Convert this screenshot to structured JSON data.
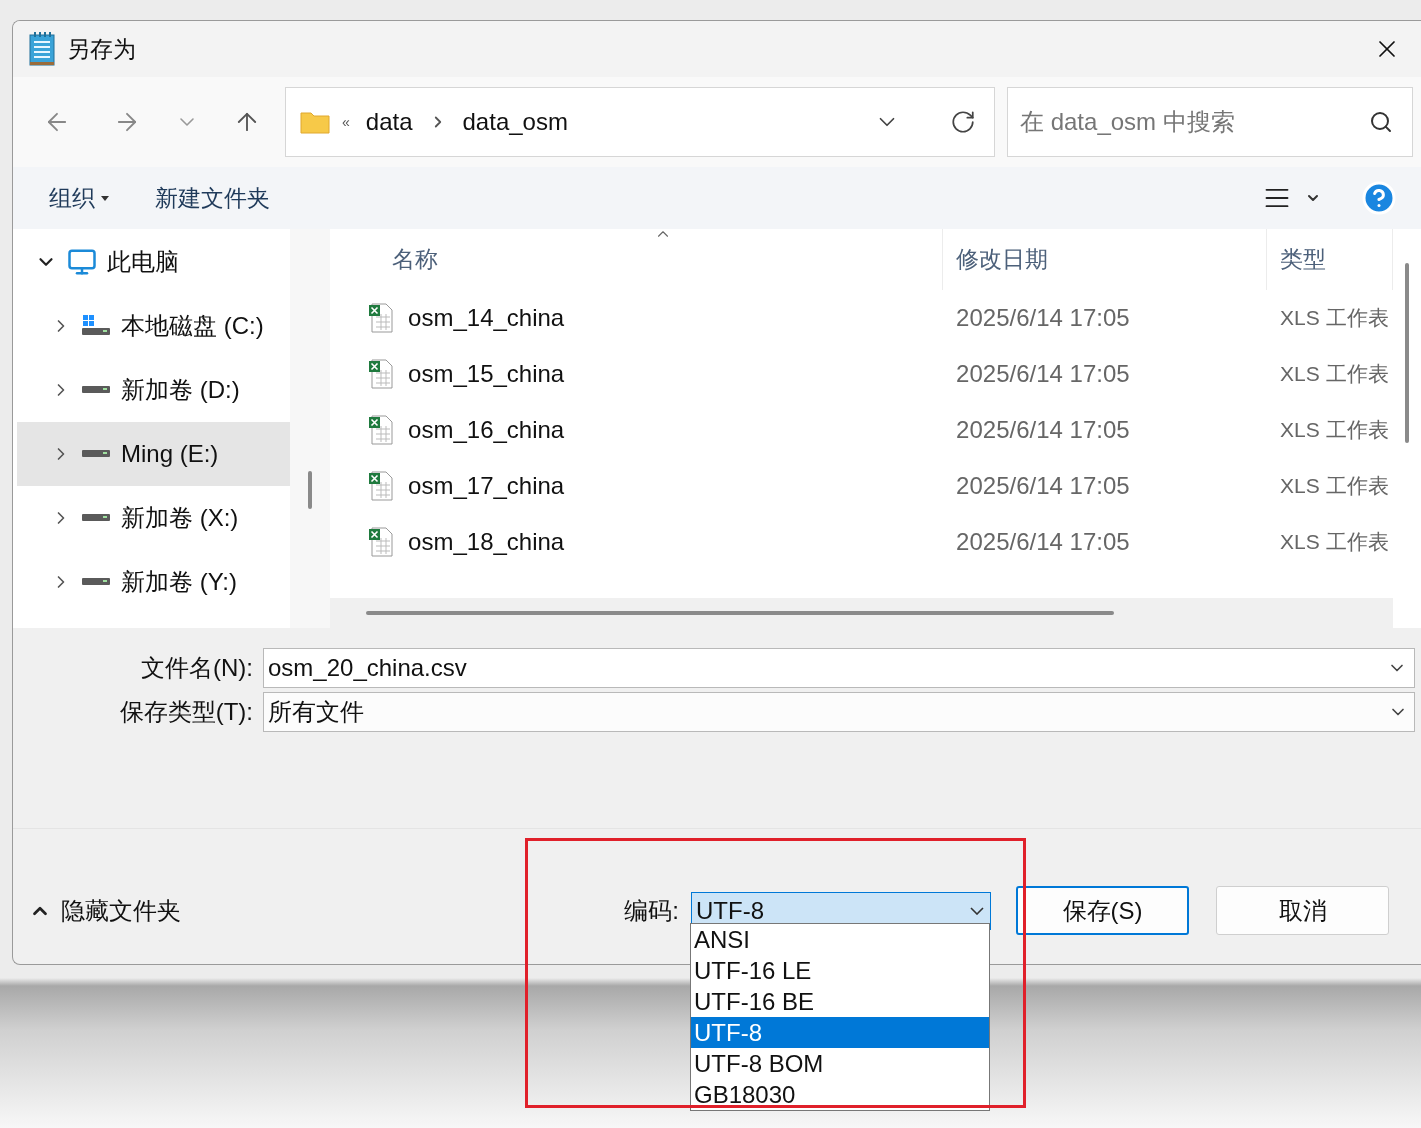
{
  "window": {
    "title": "另存为"
  },
  "address": {
    "overflow": "«",
    "path": [
      "data",
      "data_osm"
    ]
  },
  "search": {
    "placeholder": "在 data_osm 中搜索"
  },
  "toolbar": {
    "organize": "组织",
    "new_folder": "新建文件夹"
  },
  "sidebar": {
    "items": [
      {
        "label": "此电脑",
        "kind": "computer",
        "expanded": true,
        "selected": false,
        "children": [
          {
            "label": "本地磁盘 (C:)",
            "kind": "system-drive",
            "expanded": false,
            "selected": false
          },
          {
            "label": "新加卷 (D:)",
            "kind": "drive",
            "expanded": false,
            "selected": false
          },
          {
            "label": "Ming (E:)",
            "kind": "drive",
            "expanded": false,
            "selected": true
          },
          {
            "label": "新加卷 (X:)",
            "kind": "drive",
            "expanded": false,
            "selected": false
          },
          {
            "label": "新加卷 (Y:)",
            "kind": "drive",
            "expanded": false,
            "selected": false
          }
        ]
      }
    ]
  },
  "table": {
    "columns": [
      {
        "label": "名称",
        "sorted": true
      },
      {
        "label": "修改日期",
        "sorted": false
      },
      {
        "label": "类型",
        "sorted": false
      }
    ],
    "rows": [
      {
        "name": "osm_14_china",
        "modified": "2025/6/14 17:05",
        "type": "XLS 工作表"
      },
      {
        "name": "osm_15_china",
        "modified": "2025/6/14 17:05",
        "type": "XLS 工作表"
      },
      {
        "name": "osm_16_china",
        "modified": "2025/6/14 17:05",
        "type": "XLS 工作表"
      },
      {
        "name": "osm_17_china",
        "modified": "2025/6/14 17:05",
        "type": "XLS 工作表"
      },
      {
        "name": "osm_18_china",
        "modified": "2025/6/14 17:05",
        "type": "XLS 工作表"
      }
    ]
  },
  "filename": {
    "label": "文件名(N):",
    "value": "osm_20_china.csv"
  },
  "filetype": {
    "label": "保存类型(T):",
    "value": "所有文件"
  },
  "hide_folders": {
    "label": "隐藏文件夹"
  },
  "encoding": {
    "label": "编码:",
    "value": "UTF-8",
    "expanded": true,
    "options": [
      {
        "label": "ANSI",
        "selected": false
      },
      {
        "label": "UTF-16 LE",
        "selected": false
      },
      {
        "label": "UTF-16 BE",
        "selected": false
      },
      {
        "label": "UTF-8",
        "selected": true
      },
      {
        "label": "UTF-8 BOM",
        "selected": false
      },
      {
        "label": "GB18030",
        "selected": false
      }
    ]
  },
  "buttons": [
    {
      "label": "保存(S)",
      "kind": "primary"
    },
    {
      "label": "取消",
      "kind": "secondary"
    }
  ],
  "annotations": [
    {
      "kind": "rectangle",
      "color": "#e0202a"
    }
  ]
}
